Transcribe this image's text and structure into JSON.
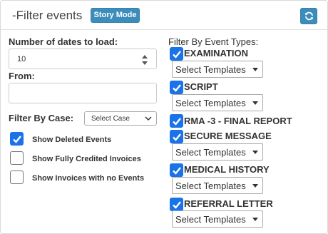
{
  "header": {
    "title": "-Filter events",
    "story_mode_label": "Story Mode",
    "refresh_icon": "refresh-icon"
  },
  "left": {
    "dates_label": "Number of dates to load:",
    "dates_value": "10",
    "from_label": "From:",
    "from_value": "",
    "case_label": "Filter By Case:",
    "case_selected": "Select Case",
    "checkboxes": [
      {
        "label": "Show Deleted Events",
        "checked": true
      },
      {
        "label": "Show Fully Credited Invoices",
        "checked": false
      },
      {
        "label": "Show Invoices with no Events",
        "checked": false
      }
    ]
  },
  "right": {
    "header": "Filter By Event Types:",
    "event_types": [
      {
        "label": "EXAMINATION",
        "checked": true,
        "template": "Select Templates"
      },
      {
        "label": "SCRIPT",
        "checked": true,
        "template": "Select Templates"
      },
      {
        "label": "RMA -3 - FINAL REPORT",
        "checked": true,
        "template": null
      },
      {
        "label": "SECURE MESSAGE",
        "checked": true,
        "template": "Select Templates"
      },
      {
        "label": "MEDICAL HISTORY",
        "checked": true,
        "template": "Select Templates"
      },
      {
        "label": "REFERRAL LETTER",
        "checked": true,
        "template": "Select Templates"
      }
    ]
  },
  "colors": {
    "accent": "#3c8dbc",
    "checkbox": "#1a73e8"
  }
}
